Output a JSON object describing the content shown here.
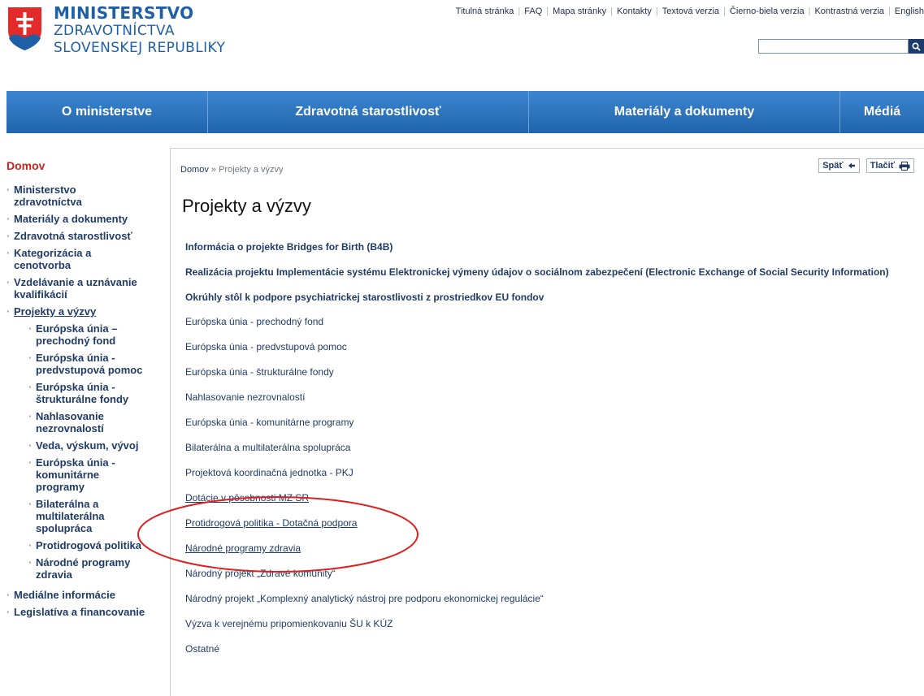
{
  "header": {
    "brand_line1": "MINISTERSTVO",
    "brand_line2": "ZDRAVOTNÍCTVA",
    "brand_line3": "SLOVENSKEJ REPUBLIKY",
    "logo_icon": "slovak-coat-of-arms",
    "top_links": [
      "Titulná stránka",
      "FAQ",
      "Mapa stránky",
      "Kontakty",
      "Textová verzia",
      "Čierno-biela verzia",
      "Kontrastná verzia",
      "English"
    ],
    "search": {
      "value": "",
      "placeholder": "",
      "button_icon": "search-icon"
    }
  },
  "nav": {
    "items": [
      "O ministerstve",
      "Zdravotná starostlivosť",
      "Materiály a dokumenty",
      "Médiá"
    ]
  },
  "sidebar": {
    "home": "Domov",
    "items": [
      {
        "label": "Ministerstvo zdravotníctva"
      },
      {
        "label": "Materiály a dokumenty"
      },
      {
        "label": "Zdravotná starostlivosť"
      },
      {
        "label": "Kategorizácia a cenotvorba"
      },
      {
        "label": "Vzdelávanie a uznávanie kvalifikácií"
      },
      {
        "label": "Projekty a výzvy"
      },
      {
        "label": "Mediálne informácie"
      },
      {
        "label": "Legislatíva a financovanie"
      }
    ],
    "subitems": [
      "Európska únia – prechodný fond",
      "Európska únia - predvstupová pomoc",
      "Európska únia - štrukturálne fondy",
      "Nahlasovanie nezrovnalostí",
      "Veda, výskum, vývoj",
      "Európska únia - komunitárne programy",
      "Bilaterálna a multilaterálna spolupráca",
      "Protidrogová politika",
      "Národné programy zdravia"
    ]
  },
  "content": {
    "breadcrumb_home": "Domov",
    "breadcrumb_sep": "»",
    "breadcrumb_current": "Projekty a výzvy",
    "back_label": "Späť",
    "print_label": "Tlačiť",
    "title": "Projekty a výzvy",
    "links": [
      "Informácia o projekte Bridges for Birth (B4B)",
      "Realizácia projektu Implementácie systému Elektronickej výmeny údajov o sociálnom zabezpečení (Electronic Exchange of Social Security Information)",
      "Okrúhly stôl k podpore psychiatrickej starostlivosti z prostriedkov EU fondov",
      "Európska únia - prechodný fond",
      "Európska únia - predvstupová pomoc",
      "Európska únia - štrukturálne fondy",
      "Nahlasovanie nezrovnalostí",
      "Európska únia - komunitárne programy",
      "Bilaterálna a multilaterálna spolupráca",
      "Projektová koordinačná jednotka - PKJ",
      "Dotácie v pôsobnosti MZ SR",
      "Protidrogová politika - Dotačná podpora",
      "Národné programy zdravia",
      "Národný projekt „Zdravé komunity“",
      "Národný projekt „Komplexný analytický nástroj pre podporu ekonomickej regulácie“",
      "Výzva k verejnému pripomienkovaniu ŠU k KÚZ",
      "Ostatné"
    ]
  },
  "colors": {
    "nav_top": "#3d86cf",
    "nav_bottom": "#1f64ad",
    "brand": "#1f5fa5",
    "sidebar_home": "#cc2222",
    "annotation": "#e02020"
  }
}
